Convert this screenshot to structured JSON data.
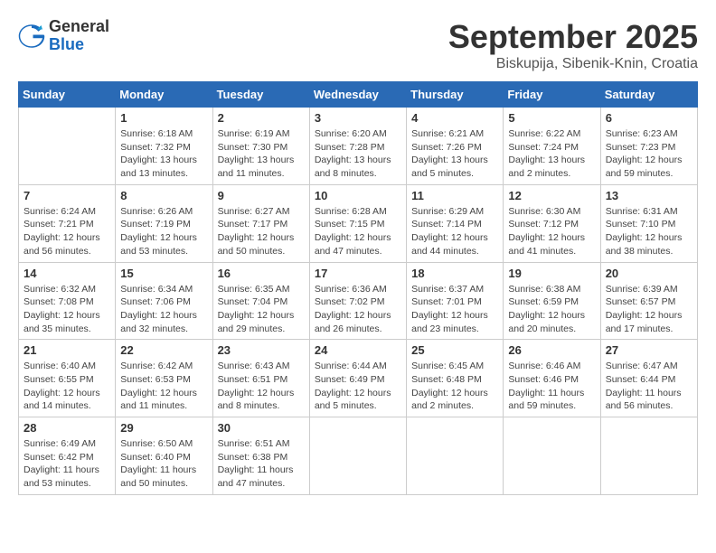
{
  "header": {
    "logo_general": "General",
    "logo_blue": "Blue",
    "month_title": "September 2025",
    "location": "Biskupija, Sibenik-Knin, Croatia"
  },
  "days_of_week": [
    "Sunday",
    "Monday",
    "Tuesday",
    "Wednesday",
    "Thursday",
    "Friday",
    "Saturday"
  ],
  "weeks": [
    [
      {
        "day": "",
        "info": ""
      },
      {
        "day": "1",
        "info": "Sunrise: 6:18 AM\nSunset: 7:32 PM\nDaylight: 13 hours\nand 13 minutes."
      },
      {
        "day": "2",
        "info": "Sunrise: 6:19 AM\nSunset: 7:30 PM\nDaylight: 13 hours\nand 11 minutes."
      },
      {
        "day": "3",
        "info": "Sunrise: 6:20 AM\nSunset: 7:28 PM\nDaylight: 13 hours\nand 8 minutes."
      },
      {
        "day": "4",
        "info": "Sunrise: 6:21 AM\nSunset: 7:26 PM\nDaylight: 13 hours\nand 5 minutes."
      },
      {
        "day": "5",
        "info": "Sunrise: 6:22 AM\nSunset: 7:24 PM\nDaylight: 13 hours\nand 2 minutes."
      },
      {
        "day": "6",
        "info": "Sunrise: 6:23 AM\nSunset: 7:23 PM\nDaylight: 12 hours\nand 59 minutes."
      }
    ],
    [
      {
        "day": "7",
        "info": "Sunrise: 6:24 AM\nSunset: 7:21 PM\nDaylight: 12 hours\nand 56 minutes."
      },
      {
        "day": "8",
        "info": "Sunrise: 6:26 AM\nSunset: 7:19 PM\nDaylight: 12 hours\nand 53 minutes."
      },
      {
        "day": "9",
        "info": "Sunrise: 6:27 AM\nSunset: 7:17 PM\nDaylight: 12 hours\nand 50 minutes."
      },
      {
        "day": "10",
        "info": "Sunrise: 6:28 AM\nSunset: 7:15 PM\nDaylight: 12 hours\nand 47 minutes."
      },
      {
        "day": "11",
        "info": "Sunrise: 6:29 AM\nSunset: 7:14 PM\nDaylight: 12 hours\nand 44 minutes."
      },
      {
        "day": "12",
        "info": "Sunrise: 6:30 AM\nSunset: 7:12 PM\nDaylight: 12 hours\nand 41 minutes."
      },
      {
        "day": "13",
        "info": "Sunrise: 6:31 AM\nSunset: 7:10 PM\nDaylight: 12 hours\nand 38 minutes."
      }
    ],
    [
      {
        "day": "14",
        "info": "Sunrise: 6:32 AM\nSunset: 7:08 PM\nDaylight: 12 hours\nand 35 minutes."
      },
      {
        "day": "15",
        "info": "Sunrise: 6:34 AM\nSunset: 7:06 PM\nDaylight: 12 hours\nand 32 minutes."
      },
      {
        "day": "16",
        "info": "Sunrise: 6:35 AM\nSunset: 7:04 PM\nDaylight: 12 hours\nand 29 minutes."
      },
      {
        "day": "17",
        "info": "Sunrise: 6:36 AM\nSunset: 7:02 PM\nDaylight: 12 hours\nand 26 minutes."
      },
      {
        "day": "18",
        "info": "Sunrise: 6:37 AM\nSunset: 7:01 PM\nDaylight: 12 hours\nand 23 minutes."
      },
      {
        "day": "19",
        "info": "Sunrise: 6:38 AM\nSunset: 6:59 PM\nDaylight: 12 hours\nand 20 minutes."
      },
      {
        "day": "20",
        "info": "Sunrise: 6:39 AM\nSunset: 6:57 PM\nDaylight: 12 hours\nand 17 minutes."
      }
    ],
    [
      {
        "day": "21",
        "info": "Sunrise: 6:40 AM\nSunset: 6:55 PM\nDaylight: 12 hours\nand 14 minutes."
      },
      {
        "day": "22",
        "info": "Sunrise: 6:42 AM\nSunset: 6:53 PM\nDaylight: 12 hours\nand 11 minutes."
      },
      {
        "day": "23",
        "info": "Sunrise: 6:43 AM\nSunset: 6:51 PM\nDaylight: 12 hours\nand 8 minutes."
      },
      {
        "day": "24",
        "info": "Sunrise: 6:44 AM\nSunset: 6:49 PM\nDaylight: 12 hours\nand 5 minutes."
      },
      {
        "day": "25",
        "info": "Sunrise: 6:45 AM\nSunset: 6:48 PM\nDaylight: 12 hours\nand 2 minutes."
      },
      {
        "day": "26",
        "info": "Sunrise: 6:46 AM\nSunset: 6:46 PM\nDaylight: 11 hours\nand 59 minutes."
      },
      {
        "day": "27",
        "info": "Sunrise: 6:47 AM\nSunset: 6:44 PM\nDaylight: 11 hours\nand 56 minutes."
      }
    ],
    [
      {
        "day": "28",
        "info": "Sunrise: 6:49 AM\nSunset: 6:42 PM\nDaylight: 11 hours\nand 53 minutes."
      },
      {
        "day": "29",
        "info": "Sunrise: 6:50 AM\nSunset: 6:40 PM\nDaylight: 11 hours\nand 50 minutes."
      },
      {
        "day": "30",
        "info": "Sunrise: 6:51 AM\nSunset: 6:38 PM\nDaylight: 11 hours\nand 47 minutes."
      },
      {
        "day": "",
        "info": ""
      },
      {
        "day": "",
        "info": ""
      },
      {
        "day": "",
        "info": ""
      },
      {
        "day": "",
        "info": ""
      }
    ]
  ]
}
